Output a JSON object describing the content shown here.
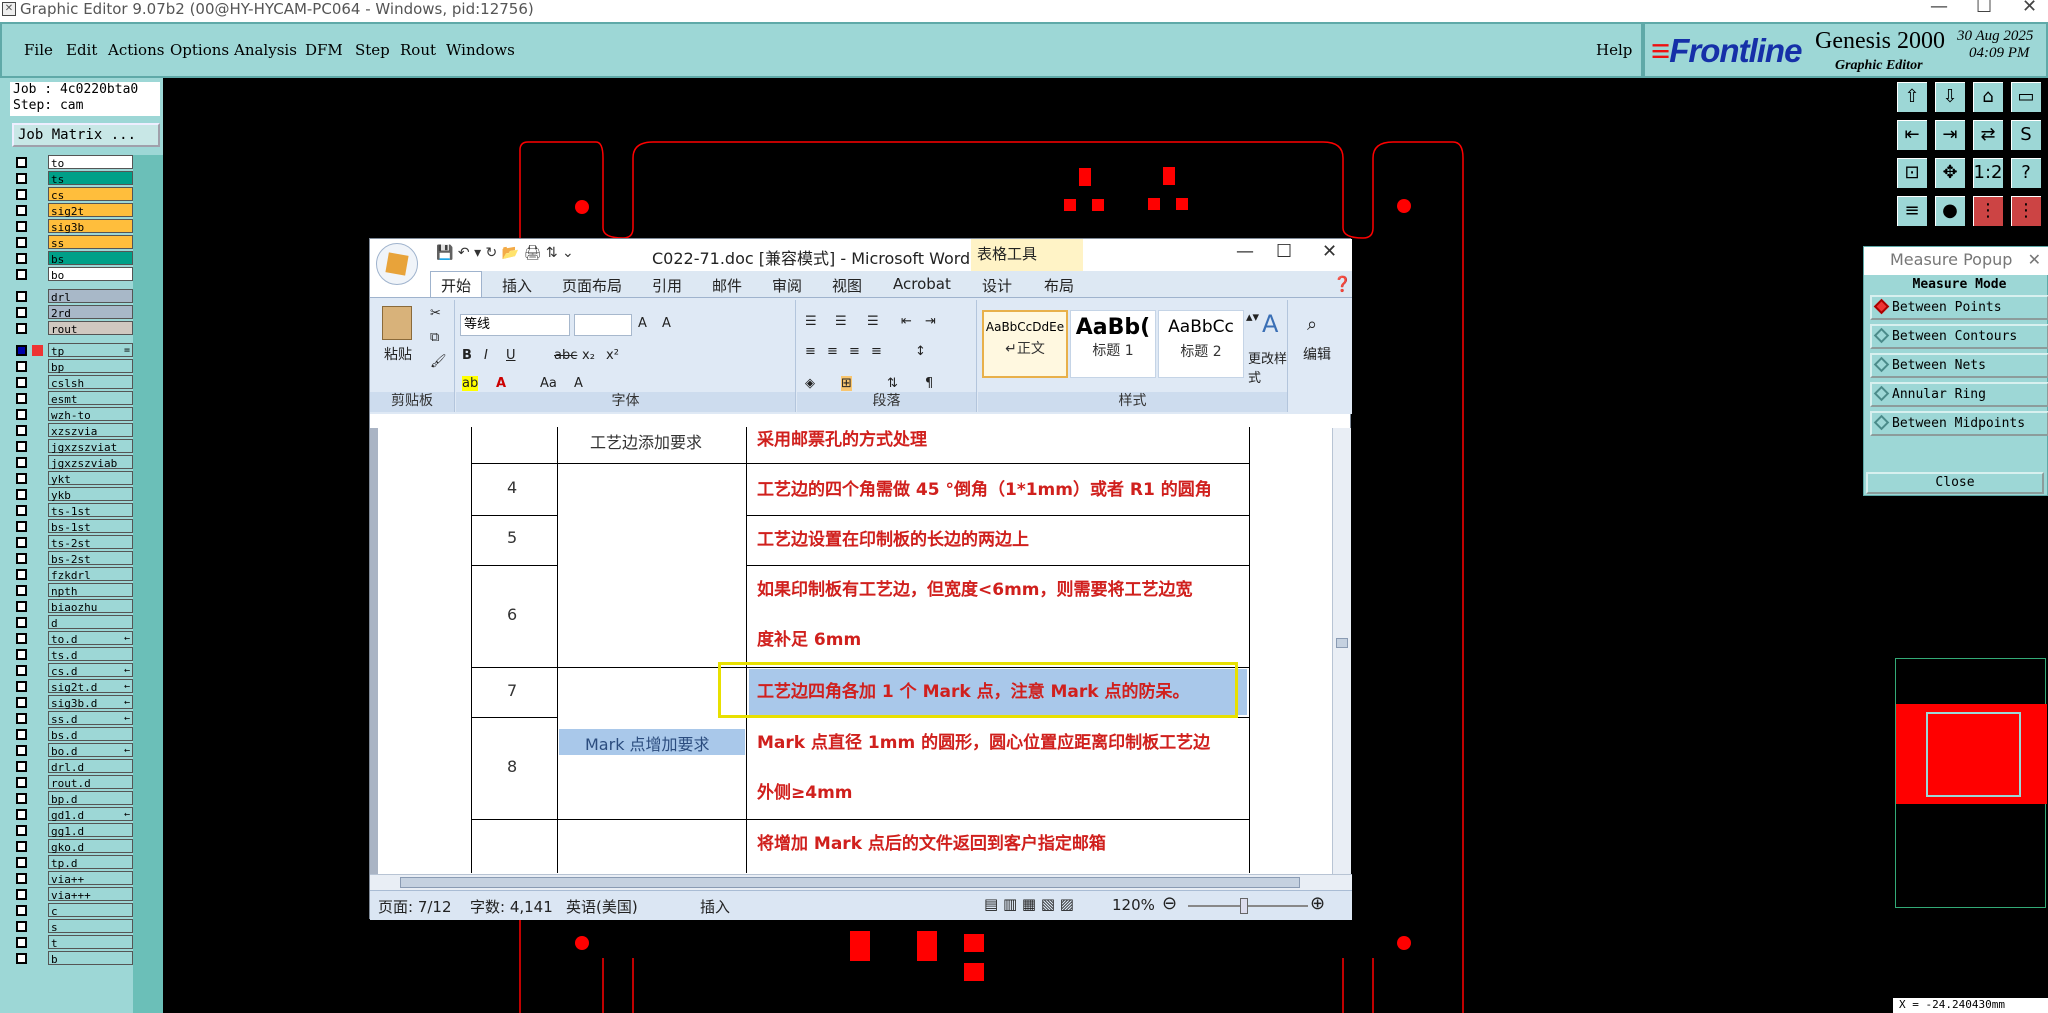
{
  "app": {
    "title": "Graphic Editor 9.07b2 (00@HY-HYCAM-PC064 - Windows, pid:12756)",
    "menu": [
      "File",
      "Edit",
      "Actions",
      "Options",
      "Analysis",
      "DFM",
      "Step",
      "Rout",
      "Windows"
    ],
    "help": "Help",
    "logo_brand": "Frontline",
    "logo_product": "Genesis 2000",
    "logo_sub": "Graphic Editor",
    "date": "30 Aug 2025",
    "time": "04:09 PM"
  },
  "left": {
    "job": "Job : 4c0220bta0",
    "step": "Step: cam",
    "job_matrix": "Job Matrix ...",
    "layers": [
      {
        "name": "to",
        "color": "#ffffff"
      },
      {
        "name": "ts",
        "color": "#00a088"
      },
      {
        "name": "cs",
        "color": "#ffbe3c"
      },
      {
        "name": "sig2t",
        "color": "#ffbe3c"
      },
      {
        "name": "sig3b",
        "color": "#ffbe3c"
      },
      {
        "name": "ss",
        "color": "#ffbe3c"
      },
      {
        "name": "bs",
        "color": "#00a088"
      },
      {
        "name": "bo",
        "color": "#ffffff"
      },
      {
        "name": "drl",
        "color": "#a8b8c8"
      },
      {
        "name": "2rd",
        "color": "#a8b8c8"
      },
      {
        "name": "rout",
        "color": "#d0c8c0"
      },
      {
        "name": "tp",
        "color": "#9dd7d6",
        "active": true
      },
      {
        "name": "bp",
        "color": "#9dd7d6"
      },
      {
        "name": "cslsh",
        "color": "#9dd7d6"
      },
      {
        "name": "esmt",
        "color": "#9dd7d6"
      },
      {
        "name": "wzh-to",
        "color": "#9dd7d6"
      },
      {
        "name": "xzszvia",
        "color": "#9dd7d6"
      },
      {
        "name": "jgxzszviat",
        "color": "#9dd7d6"
      },
      {
        "name": "jgxzszviab",
        "color": "#9dd7d6"
      },
      {
        "name": "ykt",
        "color": "#9dd7d6"
      },
      {
        "name": "ykb",
        "color": "#9dd7d6"
      },
      {
        "name": "ts-1st",
        "color": "#9dd7d6"
      },
      {
        "name": "bs-1st",
        "color": "#9dd7d6"
      },
      {
        "name": "ts-2st",
        "color": "#9dd7d6"
      },
      {
        "name": "bs-2st",
        "color": "#9dd7d6"
      },
      {
        "name": "fzkdrl",
        "color": "#9dd7d6"
      },
      {
        "name": "npth",
        "color": "#9dd7d6"
      },
      {
        "name": "biaozhu",
        "color": "#9dd7d6"
      },
      {
        "name": "d",
        "color": "#9dd7d6"
      },
      {
        "name": "to.d",
        "color": "#9dd7d6",
        "mark": "←"
      },
      {
        "name": "ts.d",
        "color": "#9dd7d6"
      },
      {
        "name": "cs.d",
        "color": "#9dd7d6",
        "mark": "←"
      },
      {
        "name": "sig2t.d",
        "color": "#9dd7d6",
        "mark": "←"
      },
      {
        "name": "sig3b.d",
        "color": "#9dd7d6",
        "mark": "←"
      },
      {
        "name": "ss.d",
        "color": "#9dd7d6",
        "mark": "←"
      },
      {
        "name": "bs.d",
        "color": "#9dd7d6"
      },
      {
        "name": "bo.d",
        "color": "#9dd7d6",
        "mark": "←"
      },
      {
        "name": "drl.d",
        "color": "#9dd7d6"
      },
      {
        "name": "rout.d",
        "color": "#9dd7d6"
      },
      {
        "name": "bp.d",
        "color": "#9dd7d6"
      },
      {
        "name": "gd1.d",
        "color": "#9dd7d6",
        "mark": "←"
      },
      {
        "name": "gg1.d",
        "color": "#9dd7d6"
      },
      {
        "name": "gko.d",
        "color": "#9dd7d6"
      },
      {
        "name": "tp.d",
        "color": "#9dd7d6"
      },
      {
        "name": "via++",
        "color": "#9dd7d6"
      },
      {
        "name": "via+++",
        "color": "#9dd7d6"
      },
      {
        "name": "c",
        "color": "#9dd7d6"
      },
      {
        "name": "s",
        "color": "#9dd7d6"
      },
      {
        "name": "t",
        "color": "#9dd7d6"
      },
      {
        "name": "b",
        "color": "#9dd7d6"
      }
    ]
  },
  "measure": {
    "title": "Measure Popup",
    "mode_label": "Measure Mode",
    "options": [
      "Between Points",
      "Between Contours",
      "Between Nets",
      "Annular Ring",
      "Between Midpoints"
    ],
    "selected": "Between Points",
    "close": "Close"
  },
  "coord": "X = -24.240430mm",
  "word": {
    "title": "C022-71.doc [兼容模式] - Microsoft Word",
    "context_tab": "表格工具",
    "tabs": [
      "开始",
      "插入",
      "页面布局",
      "引用",
      "邮件",
      "审阅",
      "视图",
      "Acrobat",
      "设计",
      "布局"
    ],
    "groups": [
      "剪贴板",
      "字体",
      "段落",
      "样式"
    ],
    "paste": "粘贴",
    "font_name": "等线",
    "styles": [
      {
        "preview": "AaBbCcDdEe",
        "name": "↵正文"
      },
      {
        "preview": "AaBb(",
        "name": "标题 1"
      },
      {
        "preview": "AaBbCc",
        "name": "标题 2"
      }
    ],
    "change_styles": "更改样式",
    "edit": "编辑",
    "status": {
      "page": "页面: 7/12",
      "words": "字数: 4,141",
      "lang": "英语(美国)",
      "mode": "插入",
      "zoom": "120%"
    },
    "table": {
      "group1": "工艺边添加要求",
      "group2": "Mark 点增加要求",
      "rows": [
        {
          "num": "",
          "text": "采用邮票孔的方式处理"
        },
        {
          "num": "4",
          "text": "工艺边的四个角需做 45 °倒角（1*1mm）或者 R1 的圆角"
        },
        {
          "num": "5",
          "text": "工艺边设置在印制板的长边的两边上"
        },
        {
          "num": "6",
          "text": "如果印制板有工艺边，但宽度<6mm，则需要将工艺边宽",
          "text2": "度补足 6mm"
        },
        {
          "num": "7",
          "text": "工艺边四角各加 1 个 Mark 点，注意 Mark 点的防呆。"
        },
        {
          "num": "8",
          "text": "Mark 点直径 1mm 的圆形，圆心位置应距离印制板工艺边",
          "text2": "外侧≥4mm"
        },
        {
          "num": "",
          "text": "将增加 Mark 点后的文件返回到客户指定邮箱"
        }
      ]
    }
  }
}
